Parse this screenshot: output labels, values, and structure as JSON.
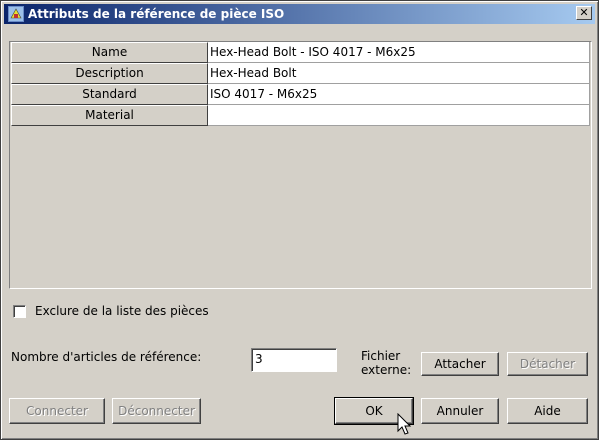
{
  "window": {
    "title": "Attributs de la référence de pièce ISO",
    "close_label": "✕"
  },
  "attributes": [
    {
      "name": "Name",
      "value": "Hex-Head Bolt - ISO 4017 - M6x25"
    },
    {
      "name": "Description",
      "value": "Hex-Head Bolt"
    },
    {
      "name": "Standard",
      "value": "ISO 4017 - M6x25"
    },
    {
      "name": "Material",
      "value": ""
    }
  ],
  "exclude": {
    "label": "Exclure de la liste des pièces",
    "checked": false
  },
  "ref_count": {
    "label": "Nombre d'articles de référence:",
    "value": "3"
  },
  "external_file": {
    "label_line1": "Fichier",
    "label_line2": "externe:",
    "attach_label": "Attacher",
    "detach_label": "Détacher"
  },
  "buttons": {
    "connect": "Connecter",
    "disconnect": "Déconnecter",
    "ok": "OK",
    "cancel": "Annuler",
    "help": "Aide"
  }
}
